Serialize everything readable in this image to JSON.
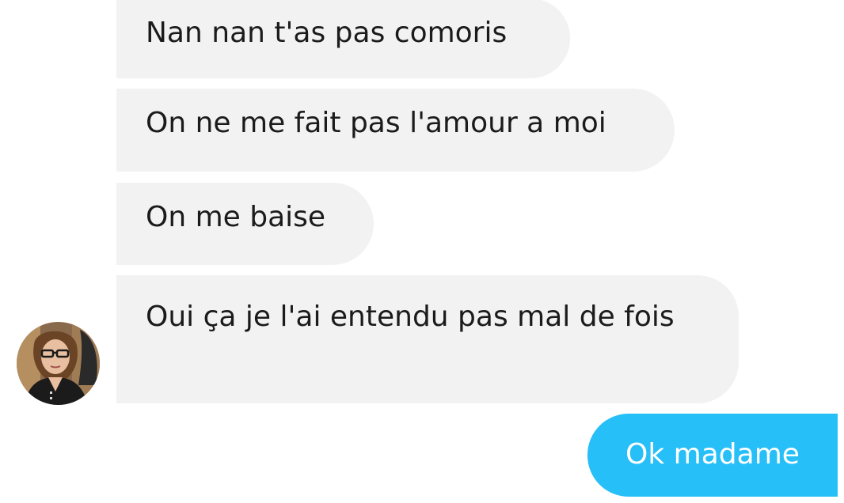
{
  "conversation": {
    "messages": [
      {
        "sender": "contact",
        "text": "Nan nan t'as pas comoris"
      },
      {
        "sender": "contact",
        "text": "On ne me fait pas l'amour a moi"
      },
      {
        "sender": "contact",
        "text": "On me baise"
      },
      {
        "sender": "contact",
        "text": "Oui ça je l'ai entendu pas mal de fois"
      },
      {
        "sender": "me",
        "text": "Ok madame"
      }
    ]
  },
  "colors": {
    "incoming_bubble": "#f2f2f2",
    "outgoing_bubble": "#27bff7",
    "incoming_text": "#1b1b1b",
    "outgoing_text": "#ffffff"
  },
  "icons": {
    "avatar": "contact-avatar-photo"
  }
}
